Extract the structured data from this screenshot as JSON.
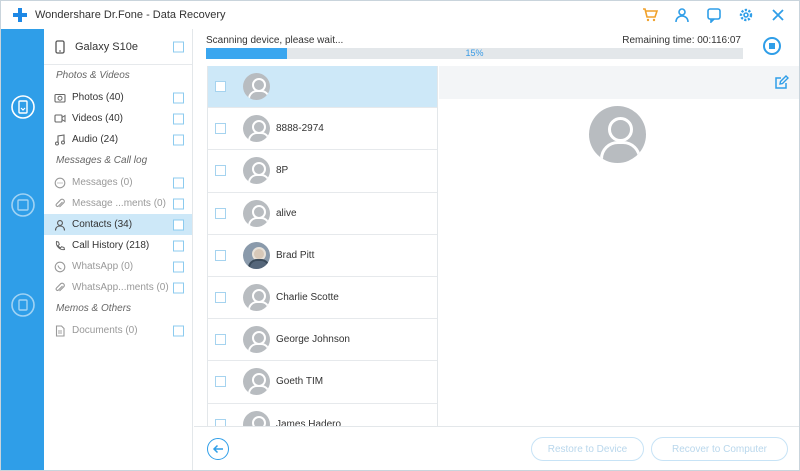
{
  "window": {
    "title": "Wondershare Dr.Fone - Data Recovery"
  },
  "colors": {
    "accent": "#2f9ee8",
    "cart": "#f0a12b",
    "selected_bg": "#cde8f8"
  },
  "titlebar_icons": [
    "cart-icon",
    "user-icon",
    "feedback-icon",
    "settings-icon",
    "close-icon"
  ],
  "rail_icons": [
    "recover-phone-icon",
    "recover-itunes-icon",
    "recover-icloud-icon"
  ],
  "device": {
    "name": "Galaxy S10e"
  },
  "categories": {
    "sections": [
      {
        "title": "Photos & Videos",
        "items": [
          {
            "label": "Photos (40)",
            "icon": "camera-icon",
            "disabled": false,
            "active": false
          },
          {
            "label": "Videos (40)",
            "icon": "video-icon",
            "disabled": false,
            "active": false
          },
          {
            "label": "Audio (24)",
            "icon": "music-icon",
            "disabled": false,
            "active": false
          }
        ]
      },
      {
        "title": "Messages & Call log",
        "items": [
          {
            "label": "Messages (0)",
            "icon": "message-icon",
            "disabled": true,
            "active": false
          },
          {
            "label": "Message ...ments (0)",
            "icon": "attachment-icon",
            "disabled": true,
            "active": false
          },
          {
            "label": "Contacts (34)",
            "icon": "contact-icon",
            "disabled": false,
            "active": true
          },
          {
            "label": "Call History (218)",
            "icon": "phone-icon",
            "disabled": false,
            "active": false
          },
          {
            "label": "WhatsApp (0)",
            "icon": "whatsapp-icon",
            "disabled": true,
            "active": false
          },
          {
            "label": "WhatsApp...ments (0)",
            "icon": "attachment-icon",
            "disabled": true,
            "active": false
          }
        ]
      },
      {
        "title": "Memos & Others",
        "items": [
          {
            "label": "Documents (0)",
            "icon": "document-icon",
            "disabled": true,
            "active": false
          }
        ]
      }
    ]
  },
  "scan": {
    "status": "Scanning device, please wait...",
    "remaining": "Remaining time: 00:116:07",
    "progress_percent": 15,
    "progress_label": "15%"
  },
  "contacts": [
    {
      "name": "",
      "selected": true,
      "photo": false
    },
    {
      "name": "8888-2974",
      "selected": false,
      "photo": false
    },
    {
      "name": "8P",
      "selected": false,
      "photo": false
    },
    {
      "name": "alive",
      "selected": false,
      "photo": false
    },
    {
      "name": "Brad Pitt",
      "selected": false,
      "photo": true
    },
    {
      "name": "Charlie Scotte",
      "selected": false,
      "photo": false
    },
    {
      "name": "George Johnson",
      "selected": false,
      "photo": false
    },
    {
      "name": "Goeth TIM",
      "selected": false,
      "photo": false
    },
    {
      "name": "James Hadero",
      "selected": false,
      "photo": false
    }
  ],
  "footer": {
    "restore_label": "Restore to Device",
    "recover_label": "Recover to Computer"
  }
}
